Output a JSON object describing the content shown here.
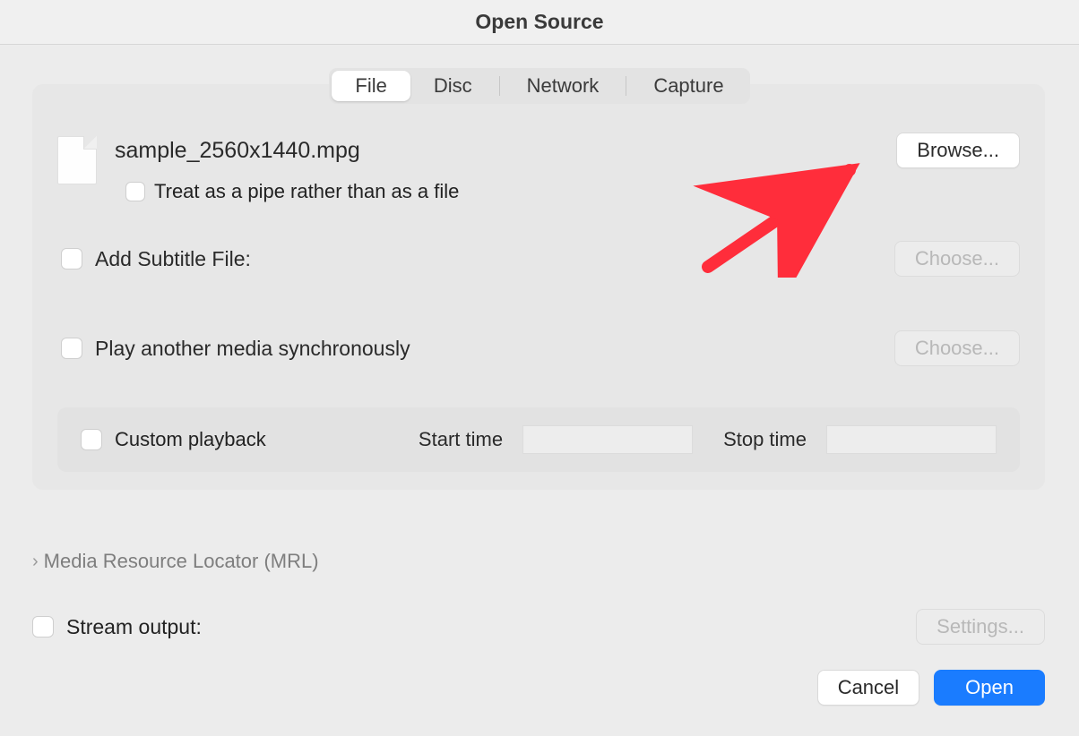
{
  "window": {
    "title": "Open Source"
  },
  "tabs": {
    "file": "File",
    "disc": "Disc",
    "network": "Network",
    "capture": "Capture"
  },
  "file": {
    "name": "sample_2560x1440.mpg",
    "pipe_label": "Treat as a pipe rather than as a file",
    "browse": "Browse..."
  },
  "subtitle": {
    "label": "Add Subtitle File:",
    "choose": "Choose..."
  },
  "sync": {
    "label": "Play another media synchronously",
    "choose": "Choose..."
  },
  "playback": {
    "custom_label": "Custom playback",
    "start_label": "Start time",
    "start_value": "",
    "stop_label": "Stop time",
    "stop_value": ""
  },
  "mrl": {
    "label": "Media Resource Locator (MRL)"
  },
  "stream": {
    "label": "Stream output:",
    "settings": "Settings..."
  },
  "footer": {
    "cancel": "Cancel",
    "open": "Open"
  }
}
